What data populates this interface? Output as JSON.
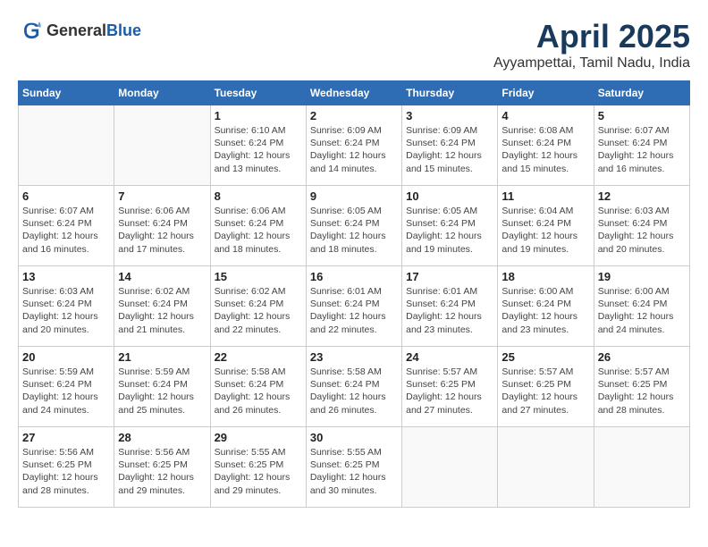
{
  "header": {
    "logo_general": "General",
    "logo_blue": "Blue",
    "month_title": "April 2025",
    "location": "Ayyampettai, Tamil Nadu, India"
  },
  "weekdays": [
    "Sunday",
    "Monday",
    "Tuesday",
    "Wednesday",
    "Thursday",
    "Friday",
    "Saturday"
  ],
  "weeks": [
    [
      {
        "day": "",
        "info": ""
      },
      {
        "day": "",
        "info": ""
      },
      {
        "day": "1",
        "info": "Sunrise: 6:10 AM\nSunset: 6:24 PM\nDaylight: 12 hours and 13 minutes."
      },
      {
        "day": "2",
        "info": "Sunrise: 6:09 AM\nSunset: 6:24 PM\nDaylight: 12 hours and 14 minutes."
      },
      {
        "day": "3",
        "info": "Sunrise: 6:09 AM\nSunset: 6:24 PM\nDaylight: 12 hours and 15 minutes."
      },
      {
        "day": "4",
        "info": "Sunrise: 6:08 AM\nSunset: 6:24 PM\nDaylight: 12 hours and 15 minutes."
      },
      {
        "day": "5",
        "info": "Sunrise: 6:07 AM\nSunset: 6:24 PM\nDaylight: 12 hours and 16 minutes."
      }
    ],
    [
      {
        "day": "6",
        "info": "Sunrise: 6:07 AM\nSunset: 6:24 PM\nDaylight: 12 hours and 16 minutes."
      },
      {
        "day": "7",
        "info": "Sunrise: 6:06 AM\nSunset: 6:24 PM\nDaylight: 12 hours and 17 minutes."
      },
      {
        "day": "8",
        "info": "Sunrise: 6:06 AM\nSunset: 6:24 PM\nDaylight: 12 hours and 18 minutes."
      },
      {
        "day": "9",
        "info": "Sunrise: 6:05 AM\nSunset: 6:24 PM\nDaylight: 12 hours and 18 minutes."
      },
      {
        "day": "10",
        "info": "Sunrise: 6:05 AM\nSunset: 6:24 PM\nDaylight: 12 hours and 19 minutes."
      },
      {
        "day": "11",
        "info": "Sunrise: 6:04 AM\nSunset: 6:24 PM\nDaylight: 12 hours and 19 minutes."
      },
      {
        "day": "12",
        "info": "Sunrise: 6:03 AM\nSunset: 6:24 PM\nDaylight: 12 hours and 20 minutes."
      }
    ],
    [
      {
        "day": "13",
        "info": "Sunrise: 6:03 AM\nSunset: 6:24 PM\nDaylight: 12 hours and 20 minutes."
      },
      {
        "day": "14",
        "info": "Sunrise: 6:02 AM\nSunset: 6:24 PM\nDaylight: 12 hours and 21 minutes."
      },
      {
        "day": "15",
        "info": "Sunrise: 6:02 AM\nSunset: 6:24 PM\nDaylight: 12 hours and 22 minutes."
      },
      {
        "day": "16",
        "info": "Sunrise: 6:01 AM\nSunset: 6:24 PM\nDaylight: 12 hours and 22 minutes."
      },
      {
        "day": "17",
        "info": "Sunrise: 6:01 AM\nSunset: 6:24 PM\nDaylight: 12 hours and 23 minutes."
      },
      {
        "day": "18",
        "info": "Sunrise: 6:00 AM\nSunset: 6:24 PM\nDaylight: 12 hours and 23 minutes."
      },
      {
        "day": "19",
        "info": "Sunrise: 6:00 AM\nSunset: 6:24 PM\nDaylight: 12 hours and 24 minutes."
      }
    ],
    [
      {
        "day": "20",
        "info": "Sunrise: 5:59 AM\nSunset: 6:24 PM\nDaylight: 12 hours and 24 minutes."
      },
      {
        "day": "21",
        "info": "Sunrise: 5:59 AM\nSunset: 6:24 PM\nDaylight: 12 hours and 25 minutes."
      },
      {
        "day": "22",
        "info": "Sunrise: 5:58 AM\nSunset: 6:24 PM\nDaylight: 12 hours and 26 minutes."
      },
      {
        "day": "23",
        "info": "Sunrise: 5:58 AM\nSunset: 6:24 PM\nDaylight: 12 hours and 26 minutes."
      },
      {
        "day": "24",
        "info": "Sunrise: 5:57 AM\nSunset: 6:25 PM\nDaylight: 12 hours and 27 minutes."
      },
      {
        "day": "25",
        "info": "Sunrise: 5:57 AM\nSunset: 6:25 PM\nDaylight: 12 hours and 27 minutes."
      },
      {
        "day": "26",
        "info": "Sunrise: 5:57 AM\nSunset: 6:25 PM\nDaylight: 12 hours and 28 minutes."
      }
    ],
    [
      {
        "day": "27",
        "info": "Sunrise: 5:56 AM\nSunset: 6:25 PM\nDaylight: 12 hours and 28 minutes."
      },
      {
        "day": "28",
        "info": "Sunrise: 5:56 AM\nSunset: 6:25 PM\nDaylight: 12 hours and 29 minutes."
      },
      {
        "day": "29",
        "info": "Sunrise: 5:55 AM\nSunset: 6:25 PM\nDaylight: 12 hours and 29 minutes."
      },
      {
        "day": "30",
        "info": "Sunrise: 5:55 AM\nSunset: 6:25 PM\nDaylight: 12 hours and 30 minutes."
      },
      {
        "day": "",
        "info": ""
      },
      {
        "day": "",
        "info": ""
      },
      {
        "day": "",
        "info": ""
      }
    ]
  ]
}
